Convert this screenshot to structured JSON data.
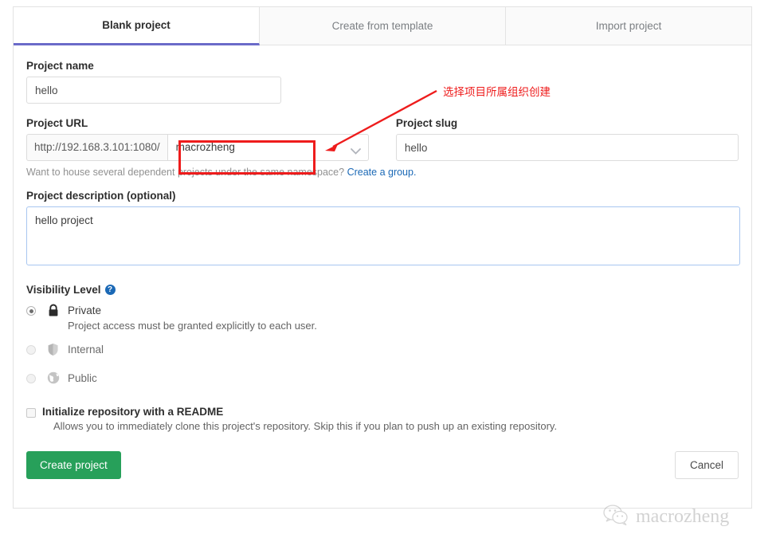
{
  "tabs": [
    {
      "label": "Blank project",
      "active": true
    },
    {
      "label": "Create from template",
      "active": false
    },
    {
      "label": "Import project",
      "active": false
    }
  ],
  "form": {
    "project_name_label": "Project name",
    "project_name_value": "hello",
    "project_url_label": "Project URL",
    "url_prefix": "http://192.168.3.101:1080/",
    "namespace_value": "macrozheng",
    "project_slug_label": "Project slug",
    "project_slug_value": "hello",
    "namespace_hint": "Want to house several dependent projects under the same namespace?",
    "namespace_hint_link": "Create a group.",
    "description_label": "Project description (optional)",
    "description_value": "hello project"
  },
  "visibility": {
    "title": "Visibility Level",
    "help_icon": "question-mark-icon",
    "options": [
      {
        "name": "Private",
        "icon": "lock-icon",
        "description": "Project access must be granted explicitly to each user.",
        "selected": true,
        "disabled": false
      },
      {
        "name": "Internal",
        "icon": "shield-icon",
        "description": "",
        "selected": false,
        "disabled": true
      },
      {
        "name": "Public",
        "icon": "globe-icon",
        "description": "",
        "selected": false,
        "disabled": true
      }
    ]
  },
  "readme": {
    "label": "Initialize repository with a README",
    "description": "Allows you to immediately clone this project's repository. Skip this if you plan to push up an existing repository.",
    "checked": false
  },
  "buttons": {
    "create_label": "Create project",
    "cancel_label": "Cancel"
  },
  "annotation": {
    "text": "选择项目所属组织创建",
    "color": "#ee1c1c"
  },
  "watermark": {
    "text": "macrozheng",
    "icon": "wechat-icon"
  },
  "colors": {
    "active_tab_underline": "#6b6bc9",
    "link": "#1b69b6",
    "primary_button": "#27a05a",
    "annotation_red": "#ee1c1c",
    "focus_border": "#a8c6f0"
  }
}
